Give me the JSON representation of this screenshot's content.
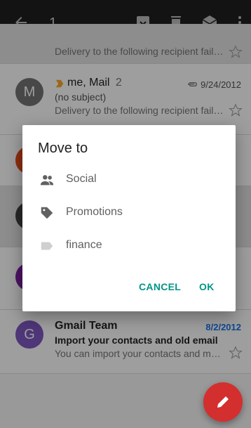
{
  "header": {
    "selected_count": "1",
    "icons": [
      "back-arrow-icon",
      "archive-icon",
      "delete-icon",
      "mark-read-icon",
      "more-vert-icon"
    ]
  },
  "emails": [
    {
      "snippet": "Delivery to the following recipient failed..."
    },
    {
      "avatar_letter": "M",
      "sender": "me, Mail",
      "count": "2",
      "date": "9/24/2012",
      "subject": "(no subject)",
      "snippet": "Delivery to the following recipient failed..."
    },
    {
      "avatar_letter": "G",
      "sender": "Gmail Team",
      "date": "8/2/2012",
      "subject": "Import your contacts and old email",
      "snippet": "You can import your contacts and mail..."
    }
  ],
  "dialog": {
    "title": "Move to",
    "options": [
      {
        "label": "Social",
        "icon": "people-icon"
      },
      {
        "label": "Promotions",
        "icon": "tag-icon"
      },
      {
        "label": "finance",
        "icon": "label-icon"
      }
    ],
    "cancel_label": "CANCEL",
    "ok_label": "OK"
  },
  "colors": {
    "accent": "#009688",
    "fab": "#d32f2f",
    "unread_date": "#1a73e8"
  }
}
